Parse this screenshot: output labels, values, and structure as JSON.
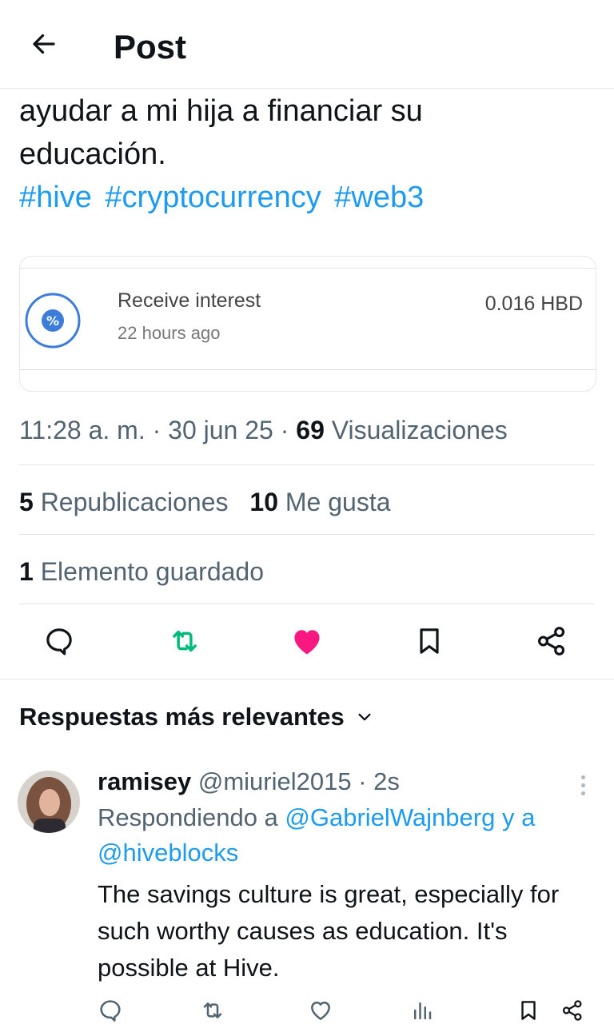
{
  "header": {
    "title": "Post"
  },
  "post": {
    "text_lines": [
      "ayudar a mi hija a financiar su",
      "educación."
    ],
    "hashtags": [
      "#hive",
      "#cryptocurrency",
      "#web3"
    ]
  },
  "card": {
    "title": "Receive interest",
    "time": "22 hours ago",
    "amount": "0.016 HBD",
    "icon": "percent-icon"
  },
  "meta": {
    "time": "11:28 a. m.",
    "date": "30 jun 25",
    "views_count": "69",
    "views_label": "Visualizaciones"
  },
  "stats": {
    "reposts_count": "5",
    "reposts_label": "Republicaciones",
    "likes_count": "10",
    "likes_label": "Me gusta",
    "bookmarks_count": "1",
    "bookmarks_label": "Elemento guardado"
  },
  "actions": {
    "icons": [
      "reply-icon",
      "repost-icon",
      "like-icon",
      "bookmark-icon",
      "share-icon"
    ],
    "colors": {
      "repost": "#00ba7c",
      "like": "#f91880",
      "link": "#1d9bf0"
    }
  },
  "replies": {
    "sort_label": "Respuestas más relevantes",
    "items": [
      {
        "name": "ramisey",
        "handle": "@miuriel2015",
        "time": "2s",
        "replying_prefix": "Respondiendo a",
        "mention1": "@GabrielWajnberg",
        "connector": "y a",
        "mention2": "@hiveblocks",
        "text": "The savings culture is great, especially for such worthy causes as education. It's possible at Hive."
      }
    ]
  }
}
